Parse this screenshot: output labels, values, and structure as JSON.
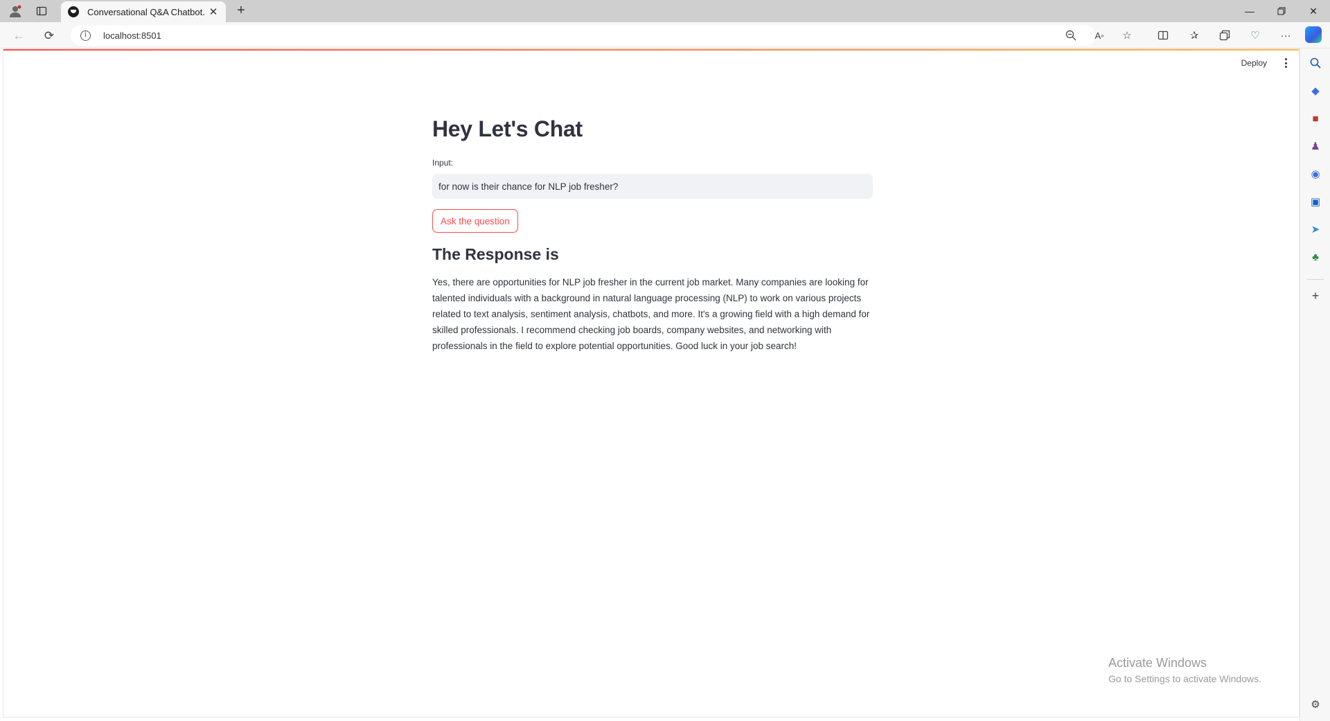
{
  "browser": {
    "tab_title": "Conversational Q&A Chatbot.",
    "url": "localhost:8501"
  },
  "app": {
    "deploy_label": "Deploy",
    "title": "Hey Let's Chat",
    "input_label": "Input:",
    "input_value": "for now is their chance for NLP job fresher?",
    "button_label": "Ask the question",
    "response_heading": "The Response is",
    "response_text": "Yes, there are opportunities for NLP job fresher in the current job market. Many companies are looking for talented individuals with a background in natural language processing (NLP) to work on various projects related to text analysis, sentiment analysis, chatbots, and more. It's a growing field with a high demand for skilled professionals. I recommend checking job boards, company websites, and networking with professionals in the field to explore potential opportunities. Good luck in your job search!"
  },
  "watermark": {
    "line1": "Activate Windows",
    "line2": "Go to Settings to activate Windows."
  },
  "colors": {
    "accent": "#ff4b4b",
    "input_bg": "#f0f2f6",
    "text": "#31333f"
  }
}
